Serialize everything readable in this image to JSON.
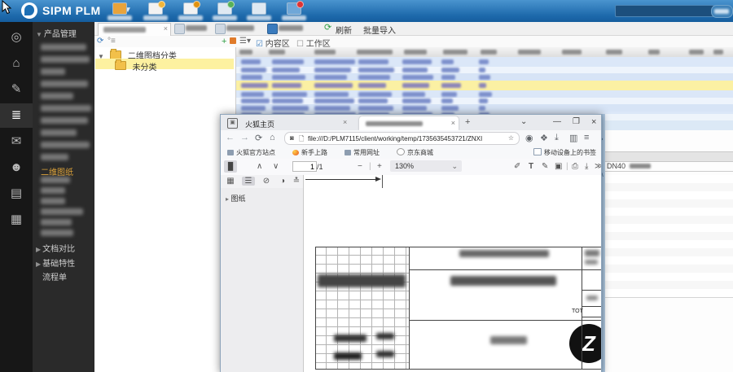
{
  "topbar": {
    "app_title": "SIPM PLM"
  },
  "sidebar": {
    "section_label": "产品管理",
    "active_item_label": "二维图纸",
    "groups": [
      {
        "label": "文档对比"
      },
      {
        "label": "基础特性"
      },
      {
        "label": "流程单"
      }
    ]
  },
  "workspace": {
    "toolbar": {
      "refresh": "刷新",
      "batch_import": "批量导入",
      "view_content": "内容区",
      "view_workspace": "工作区"
    },
    "tree": {
      "root": "二维图档分类",
      "child": "未分类"
    }
  },
  "right_panel": {
    "visible_value": "DN40"
  },
  "browser": {
    "tabs": {
      "home_tab": "火狐主页"
    },
    "address": {
      "url": "file:///D:/PLM7115/client/working/temp/1735635453721/ZNXI"
    },
    "bookmarks": {
      "items": [
        {
          "label": "火狐官方站点"
        },
        {
          "label": "新手上路"
        },
        {
          "label": "常用网址"
        },
        {
          "label": "京东商城"
        }
      ],
      "right_label": "移动设备上的书签"
    },
    "pdf": {
      "page": "1",
      "page_count": "/1",
      "zoom": "130%",
      "outline_item": "图纸",
      "titleblock_text": "TOT",
      "logo_letter": "Z"
    }
  }
}
